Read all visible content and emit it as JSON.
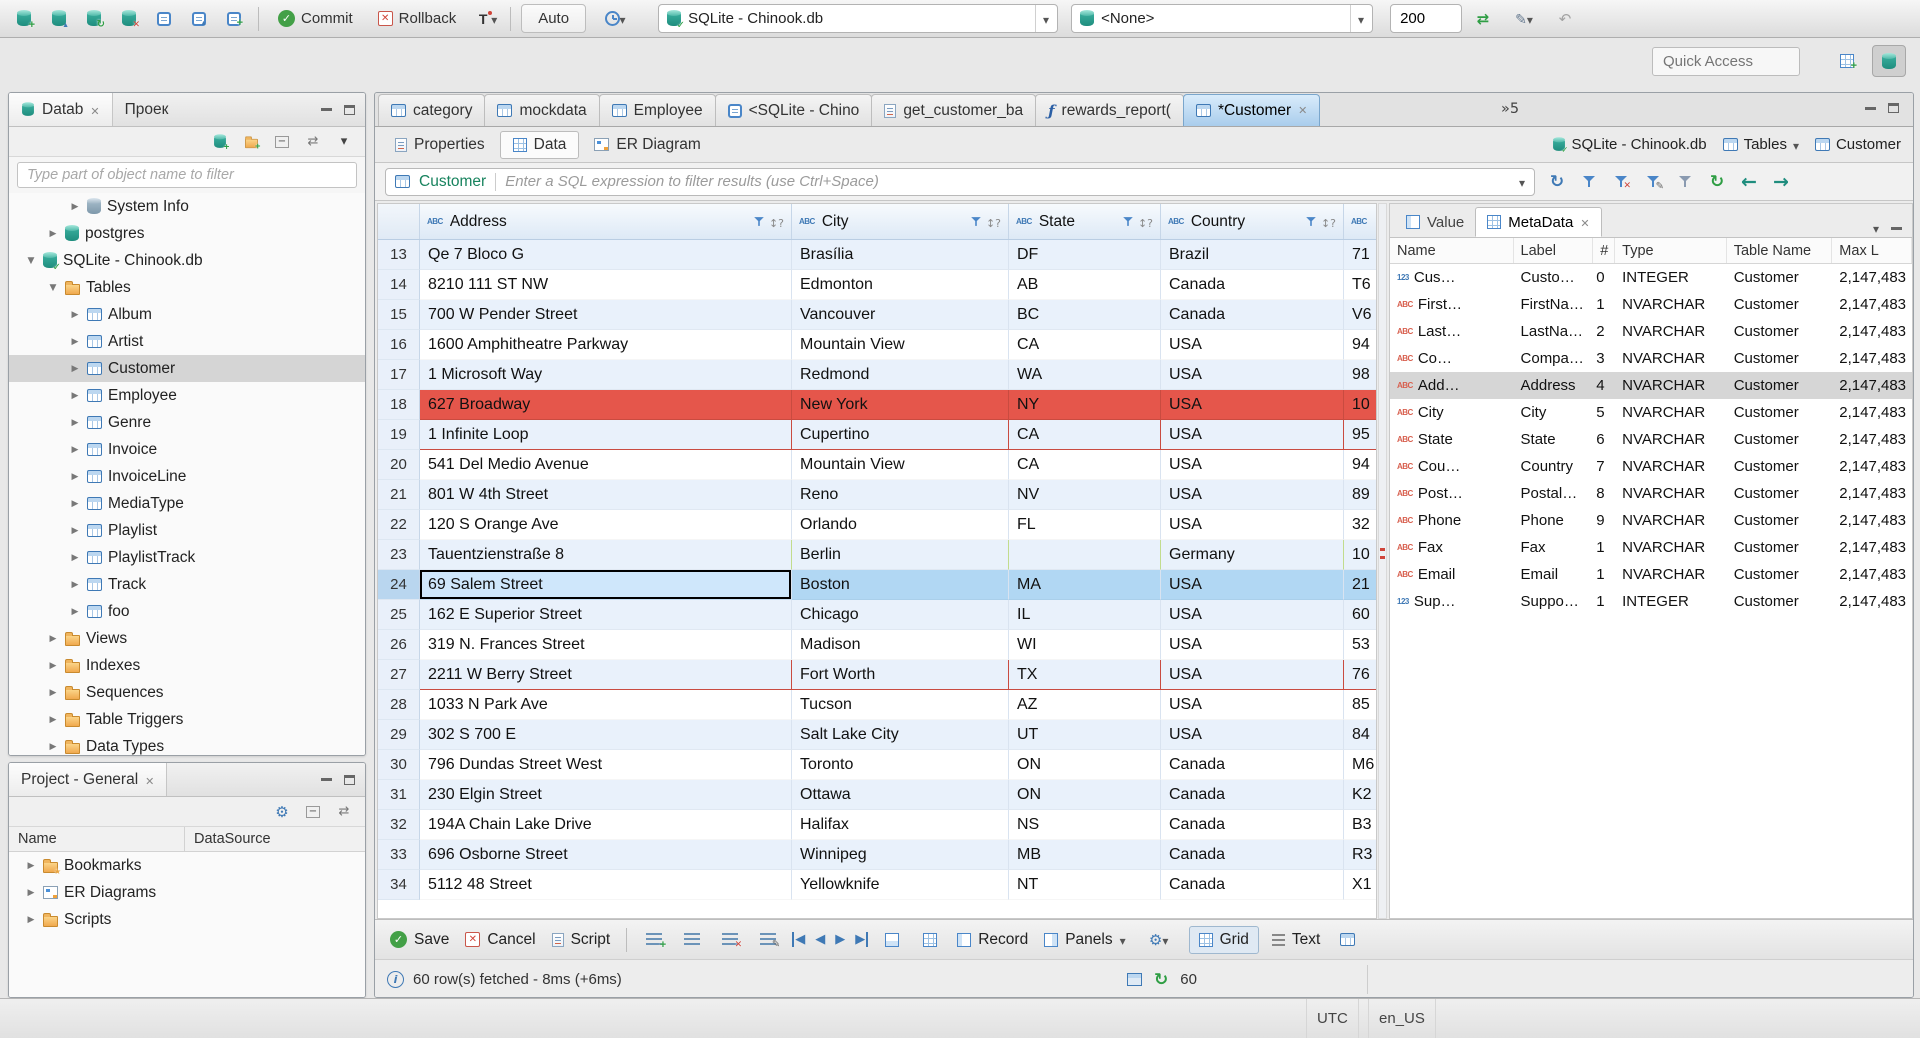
{
  "colors": {
    "selection": "#b1d7f3",
    "row_red": "#e5564b",
    "row_green": "#dcf0a8",
    "db_teal": "#2a9c8c",
    "accent_blue": "#3f79b5",
    "entity_green": "#18835e"
  },
  "icons": [
    "new-connection-icon",
    "connect-icon",
    "reconnect-icon",
    "disconnect-icon",
    "sql-editor-icon",
    "open-sql-script-icon",
    "new-sql-editor-icon",
    "commit-icon",
    "rollback-icon",
    "transaction-mode-icon",
    "transaction-log-icon",
    "database-icon",
    "schema-icon",
    "sync-with-editor-icon",
    "mock-data-icon",
    "undo-icon",
    "table-icon",
    "folder-icon",
    "funnel-icon",
    "refresh-icon",
    "gear-icon",
    "info-icon",
    "grid-icon",
    "text-icon",
    "close-icon",
    "caret-down-icon"
  ],
  "top_toolbar": {
    "commit": "Commit",
    "rollback": "Rollback",
    "auto": "Auto",
    "connection": "SQLite - Chinook.db",
    "schema": "<None>",
    "fetch_size": "200"
  },
  "quick_access": {
    "placeholder": "Quick Access"
  },
  "db_navigator": {
    "tabs": [
      {
        "label": "Datab"
      },
      {
        "label": "Проек"
      }
    ],
    "filter_placeholder": "Type part of object name to filter",
    "tree": [
      {
        "label": "System Info",
        "indent": 2,
        "arrow": "col",
        "icon": "ic-sysinfo",
        "state": ""
      },
      {
        "label": "postgres",
        "indent": 1,
        "arrow": "col",
        "icon": "ic-db",
        "state": ""
      },
      {
        "label": "SQLite - Chinook.db",
        "indent": 0,
        "arrow": "exp",
        "icon": "ic-db b-check",
        "state": ""
      },
      {
        "label": "Tables",
        "indent": 1,
        "arrow": "exp",
        "icon": "ic-folder",
        "state": ""
      },
      {
        "label": "Album",
        "indent": 2,
        "arrow": "col",
        "icon": "ic-table",
        "state": ""
      },
      {
        "label": "Artist",
        "indent": 2,
        "arrow": "col",
        "icon": "ic-table",
        "state": ""
      },
      {
        "label": "Customer",
        "indent": 2,
        "arrow": "col",
        "icon": "ic-table",
        "state": "selected"
      },
      {
        "label": "Employee",
        "indent": 2,
        "arrow": "col",
        "icon": "ic-table",
        "state": ""
      },
      {
        "label": "Genre",
        "indent": 2,
        "arrow": "col",
        "icon": "ic-table",
        "state": ""
      },
      {
        "label": "Invoice",
        "indent": 2,
        "arrow": "col",
        "icon": "ic-table",
        "state": ""
      },
      {
        "label": "InvoiceLine",
        "indent": 2,
        "arrow": "col",
        "icon": "ic-table",
        "state": ""
      },
      {
        "label": "MediaType",
        "indent": 2,
        "arrow": "col",
        "icon": "ic-table",
        "state": ""
      },
      {
        "label": "Playlist",
        "indent": 2,
        "arrow": "col",
        "icon": "ic-table",
        "state": ""
      },
      {
        "label": "PlaylistTrack",
        "indent": 2,
        "arrow": "col",
        "icon": "ic-table",
        "state": ""
      },
      {
        "label": "Track",
        "indent": 2,
        "arrow": "col",
        "icon": "ic-table",
        "state": ""
      },
      {
        "label": "foo",
        "indent": 2,
        "arrow": "col",
        "icon": "ic-table",
        "state": ""
      },
      {
        "label": "Views",
        "indent": 1,
        "arrow": "col",
        "icon": "ic-folder",
        "state": ""
      },
      {
        "label": "Indexes",
        "indent": 1,
        "arrow": "col",
        "icon": "ic-folder",
        "state": ""
      },
      {
        "label": "Sequences",
        "indent": 1,
        "arrow": "col",
        "icon": "ic-folder",
        "state": ""
      },
      {
        "label": "Table Triggers",
        "indent": 1,
        "arrow": "col",
        "icon": "ic-folder",
        "state": ""
      },
      {
        "label": "Data Types",
        "indent": 1,
        "arrow": "col",
        "icon": "ic-folder",
        "state": ""
      }
    ]
  },
  "project_panel": {
    "title": "Project - General",
    "columns": {
      "name": "Name",
      "datasource": "DataSource"
    },
    "tree": [
      {
        "label": "Bookmarks",
        "arrow": "col",
        "icon": "ic-folder b-star",
        "state": ""
      },
      {
        "label": "ER Diagrams",
        "arrow": "col",
        "icon": "ic-erd",
        "state": ""
      },
      {
        "label": "Scripts",
        "arrow": "col",
        "icon": "ic-folder",
        "state": ""
      }
    ]
  },
  "editor_tabs": {
    "tabs": [
      {
        "label": "category",
        "icon": "ic-table",
        "state": "",
        "close": ""
      },
      {
        "label": "mockdata",
        "icon": "ic-table",
        "state": "",
        "close": ""
      },
      {
        "label": "Employee",
        "icon": "ic-table",
        "state": "",
        "close": ""
      },
      {
        "label": "<SQLite - Chino",
        "icon": "ic-sqlpage",
        "state": "",
        "close": ""
      },
      {
        "label": "get_customer_ba",
        "icon": "ic-script",
        "state": "",
        "close": ""
      },
      {
        "label": "rewards_report(",
        "icon": "ic-func",
        "state": "",
        "close": ""
      },
      {
        "label": "*Customer",
        "icon": "ic-table",
        "state": "active",
        "close": "show"
      }
    ],
    "overflow": "»5"
  },
  "result_tabs": {
    "properties": "Properties",
    "data": "Data",
    "er_diagram": "ER Diagram",
    "context": {
      "connection": "SQLite - Chinook.db",
      "container": "Tables",
      "entity": "Customer"
    }
  },
  "filter_bar": {
    "entity": "Customer",
    "placeholder": "Enter a SQL expression to filter results (use Ctrl+Space)"
  },
  "grid": {
    "columns": [
      {
        "label": "Address",
        "cls": ""
      },
      {
        "label": "City",
        "cls": ""
      },
      {
        "label": "State",
        "cls": ""
      },
      {
        "label": "Country",
        "cls": ""
      },
      {
        "label": "",
        "cls": "clip"
      }
    ],
    "rows": [
      {
        "num": "13",
        "state": "",
        "cells": [
          "Qe 7 Bloco G",
          "Brasília",
          "DF",
          "Brazil",
          "71"
        ]
      },
      {
        "num": "14",
        "state": "",
        "cells": [
          "8210 111 ST NW",
          "Edmonton",
          "AB",
          "Canada",
          "T6"
        ]
      },
      {
        "num": "15",
        "state": "",
        "cells": [
          "700 W Pender Street",
          "Vancouver",
          "BC",
          "Canada",
          "V6"
        ]
      },
      {
        "num": "16",
        "state": "",
        "cells": [
          "1600 Amphitheatre Parkway",
          "Mountain View",
          "CA",
          "USA",
          "94"
        ]
      },
      {
        "num": "17",
        "state": "",
        "cells": [
          "1 Microsoft Way",
          "Redmond",
          "WA",
          "USA",
          "98"
        ]
      },
      {
        "num": "18",
        "state": "red",
        "cells": [
          "627 Broadway",
          "New York",
          "NY",
          "USA",
          "10"
        ]
      },
      {
        "num": "19",
        "state": "red",
        "cells": [
          "1 Infinite Loop",
          "Cupertino",
          "CA",
          "USA",
          "95"
        ]
      },
      {
        "num": "20",
        "state": "",
        "cells": [
          "541 Del Medio Avenue",
          "Mountain View",
          "CA",
          "USA",
          "94"
        ]
      },
      {
        "num": "21",
        "state": "",
        "cells": [
          "801 W 4th Street",
          "Reno",
          "NV",
          "USA",
          "89"
        ]
      },
      {
        "num": "22",
        "state": "",
        "cells": [
          "120 S Orange Ave",
          "Orlando",
          "FL",
          "USA",
          "32"
        ]
      },
      {
        "num": "23",
        "state": "green",
        "cells": [
          "Tauentzienstraße 8",
          "Berlin",
          "",
          "Germany",
          "10"
        ]
      },
      {
        "num": "24",
        "state": "sel",
        "cells": [
          "69 Salem Street",
          "Boston",
          "MA",
          "USA",
          "21"
        ]
      },
      {
        "num": "25",
        "state": "",
        "cells": [
          "162 E Superior Street",
          "Chicago",
          "IL",
          "USA",
          "60"
        ]
      },
      {
        "num": "26",
        "state": "",
        "cells": [
          "319 N. Frances Street",
          "Madison",
          "WI",
          "USA",
          "53"
        ]
      },
      {
        "num": "27",
        "state": "red",
        "cells": [
          "2211 W Berry Street",
          "Fort Worth",
          "TX",
          "USA",
          "76"
        ]
      },
      {
        "num": "28",
        "state": "",
        "cells": [
          "1033 N Park Ave",
          "Tucson",
          "AZ",
          "USA",
          "85"
        ]
      },
      {
        "num": "29",
        "state": "",
        "cells": [
          "302 S 700 E",
          "Salt Lake City",
          "UT",
          "USA",
          "84"
        ]
      },
      {
        "num": "30",
        "state": "",
        "cells": [
          "796 Dundas Street West",
          "Toronto",
          "ON",
          "Canada",
          "M6"
        ]
      },
      {
        "num": "31",
        "state": "",
        "cells": [
          "230 Elgin Street",
          "Ottawa",
          "ON",
          "Canada",
          "K2"
        ]
      },
      {
        "num": "32",
        "state": "",
        "cells": [
          "194A Chain Lake Drive",
          "Halifax",
          "NS",
          "Canada",
          "B3"
        ]
      },
      {
        "num": "33",
        "state": "",
        "cells": [
          "696 Osborne Street",
          "Winnipeg",
          "MB",
          "Canada",
          "R3"
        ]
      },
      {
        "num": "34",
        "state": "",
        "cells": [
          "5112 48 Street",
          "Yellowknife",
          "NT",
          "Canada",
          "X1"
        ]
      }
    ]
  },
  "side_panel": {
    "tabs": {
      "value": "Value",
      "metadata": "MetaData"
    },
    "meta_columns": {
      "name": "Name",
      "label": "Label",
      "num": "#",
      "type": "Type",
      "table": "Table Name",
      "max": "Max L"
    },
    "meta_rows": [
      {
        "icon": "ic-123",
        "state": "",
        "name": "Cus…",
        "label": "Custo…",
        "num": "0",
        "type": "INTEGER",
        "table": "Customer",
        "max": "2,147,483"
      },
      {
        "icon": "ic-abc",
        "state": "",
        "name": "First…",
        "label": "FirstNa…",
        "num": "1",
        "type": "NVARCHAR",
        "table": "Customer",
        "max": "2,147,483"
      },
      {
        "icon": "ic-abc",
        "state": "",
        "name": "Last…",
        "label": "LastNa…",
        "num": "2",
        "type": "NVARCHAR",
        "table": "Customer",
        "max": "2,147,483"
      },
      {
        "icon": "ic-abc",
        "state": "",
        "name": "Co…",
        "label": "Compa…",
        "num": "3",
        "type": "NVARCHAR",
        "table": "Customer",
        "max": "2,147,483"
      },
      {
        "icon": "ic-abc",
        "state": "selected",
        "name": "Add…",
        "label": "Address",
        "num": "4",
        "type": "NVARCHAR",
        "table": "Customer",
        "max": "2,147,483"
      },
      {
        "icon": "ic-abc",
        "state": "",
        "name": "City",
        "label": "City",
        "num": "5",
        "type": "NVARCHAR",
        "table": "Customer",
        "max": "2,147,483"
      },
      {
        "icon": "ic-abc",
        "state": "",
        "name": "State",
        "label": "State",
        "num": "6",
        "type": "NVARCHAR",
        "table": "Customer",
        "max": "2,147,483"
      },
      {
        "icon": "ic-abc",
        "state": "",
        "name": "Cou…",
        "label": "Country",
        "num": "7",
        "type": "NVARCHAR",
        "table": "Customer",
        "max": "2,147,483"
      },
      {
        "icon": "ic-abc",
        "state": "",
        "name": "Post…",
        "label": "Postal…",
        "num": "8",
        "type": "NVARCHAR",
        "table": "Customer",
        "max": "2,147,483"
      },
      {
        "icon": "ic-abc",
        "state": "",
        "name": "Phone",
        "label": "Phone",
        "num": "9",
        "type": "NVARCHAR",
        "table": "Customer",
        "max": "2,147,483"
      },
      {
        "icon": "ic-abc",
        "state": "",
        "name": "Fax",
        "label": "Fax",
        "num": "1",
        "type": "NVARCHAR",
        "table": "Customer",
        "max": "2,147,483"
      },
      {
        "icon": "ic-abc",
        "state": "",
        "name": "Email",
        "label": "Email",
        "num": "1",
        "type": "NVARCHAR",
        "table": "Customer",
        "max": "2,147,483"
      },
      {
        "icon": "ic-123",
        "state": "",
        "name": "Sup…",
        "label": "Suppo…",
        "num": "1",
        "type": "INTEGER",
        "table": "Customer",
        "max": "2,147,483"
      }
    ]
  },
  "bottom_toolbar": {
    "save": "Save",
    "cancel": "Cancel",
    "script": "Script",
    "record": "Record",
    "panels": "Panels",
    "grid": "Grid",
    "text": "Text"
  },
  "status_row": {
    "message": "60 row(s) fetched - 8ms (+6ms)",
    "auto_refresh": "60"
  },
  "status_bar": {
    "timezone": "UTC",
    "locale": "en_US"
  }
}
